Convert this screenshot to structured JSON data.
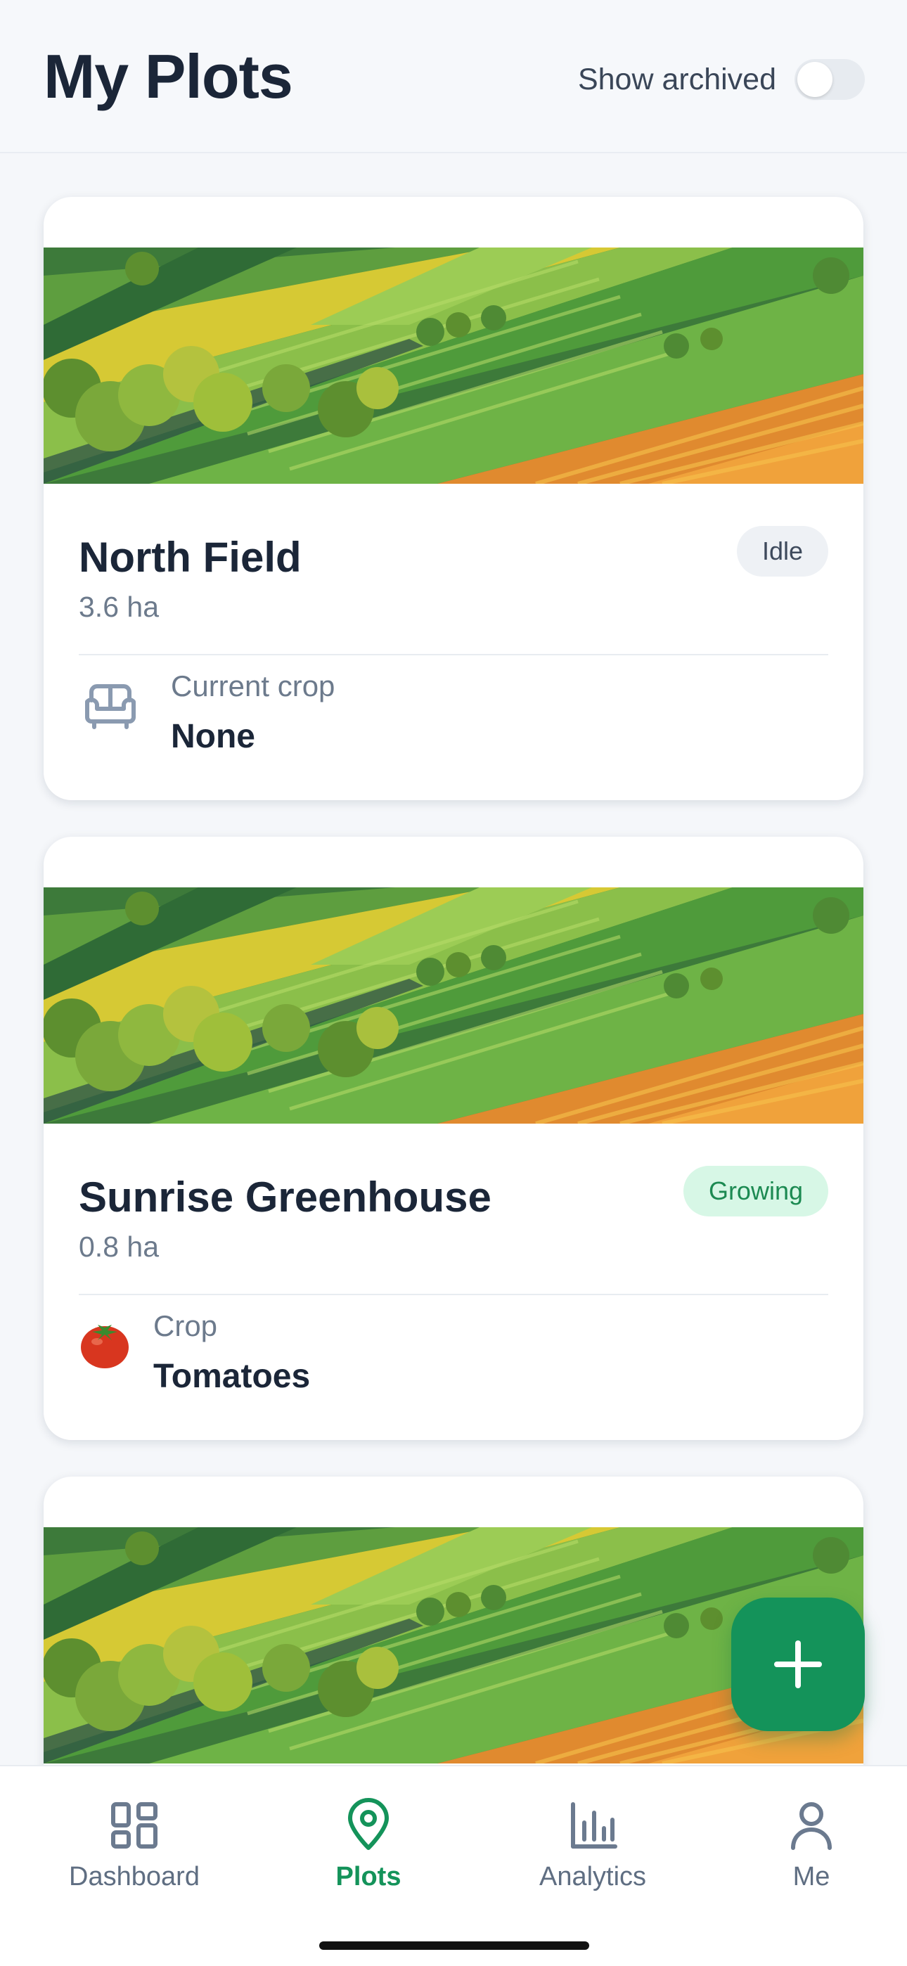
{
  "header": {
    "title": "My Plots",
    "archived_label": "Show archived",
    "archived_enabled": false
  },
  "plots": [
    {
      "name": "North Field",
      "area": "3.6 ha",
      "status": "Idle",
      "crop_label": "Current crop",
      "crop_value": "None",
      "crop_icon": "sofa-icon"
    },
    {
      "name": "Sunrise Greenhouse",
      "area": "0.8 ha",
      "status": "Growing",
      "crop_label": "Crop",
      "crop_value": "Tomatoes",
      "crop_icon": "tomato-icon"
    },
    {
      "partial": true
    }
  ],
  "fab": {
    "icon": "plus-icon"
  },
  "nav": {
    "items": [
      {
        "label": "Dashboard",
        "icon": "dashboard-icon",
        "active": false
      },
      {
        "label": "Plots",
        "icon": "location-pin-icon",
        "active": true
      },
      {
        "label": "Analytics",
        "icon": "bar-chart-icon",
        "active": false
      },
      {
        "label": "Me",
        "icon": "user-icon",
        "active": false
      }
    ]
  },
  "colors": {
    "accent": "#14935a",
    "text_primary": "#1b2638",
    "text_secondary": "#6c7a8c",
    "background": "#f5f7fa",
    "idle_badge_bg": "#eef1f5",
    "growing_badge_bg": "#d7f7e6"
  }
}
